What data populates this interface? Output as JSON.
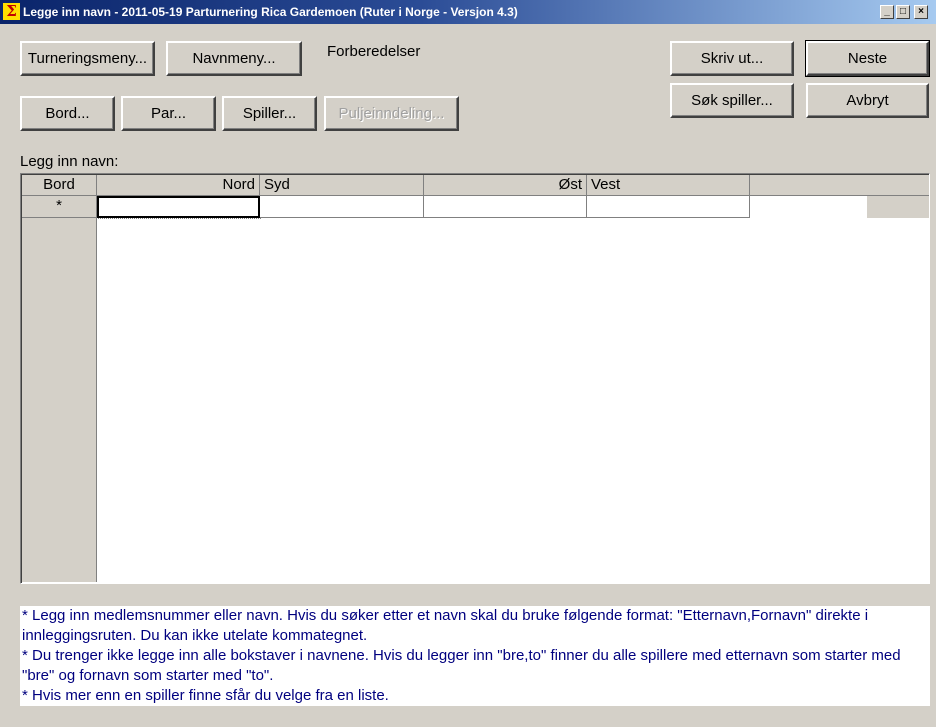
{
  "window": {
    "title": "Legge inn navn - 2011-05-19  Parturnering Rica Gardemoen  (Ruter i Norge - Versjon 4.3)",
    "icon_glyph": "Σ",
    "controls": {
      "minimize": "_",
      "maximize": "□",
      "close": "×"
    }
  },
  "toolbar": {
    "turneringsmeny": "Turneringsmeny...",
    "navnmeny": "Navnmeny...",
    "section_label": "Forberedelser",
    "bord": "Bord...",
    "par": "Par...",
    "spiller": "Spiller...",
    "puljeinndeling": "Puljeinndeling...",
    "skriv_ut": "Skriv ut...",
    "sok_spiller": "Søk spiller...",
    "neste": "Neste",
    "avbryt": "Avbryt"
  },
  "grid": {
    "caption": "Legg inn navn:",
    "columns": [
      "Bord",
      "Nord",
      "Syd",
      "Øst",
      "Vest"
    ],
    "new_row_marker": "*",
    "rows": [
      {
        "Nord": "",
        "Syd": "",
        "Øst": "",
        "Vest": ""
      }
    ]
  },
  "help": [
    "* Legg inn medlemsnummer eller navn. Hvis du søker etter et navn skal du bruke følgende format: \"Etternavn,Fornavn\" direkte i innleggingsruten. Du kan ikke utelate kommategnet.",
    "* Du trenger ikke legge inn alle bokstaver i navnene. Hvis du legger inn \"bre,to\" finner du alle spillere med etternavn som starter med \"bre\" og fornavn som starter med \"to\".",
    "* Hvis mer enn en spiller finne sfår du velge fra en liste."
  ]
}
